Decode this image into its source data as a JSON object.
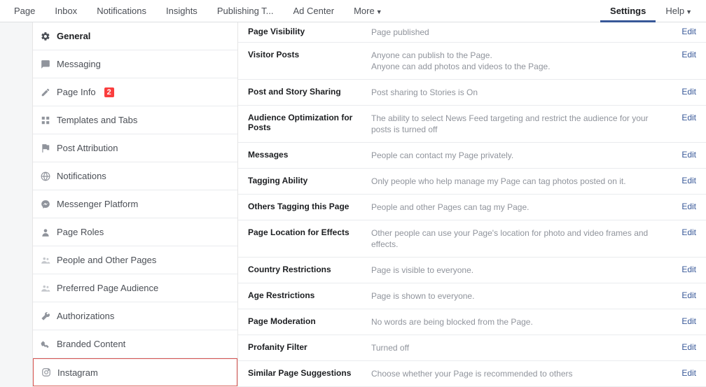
{
  "topnav": {
    "left": [
      {
        "label": "Page"
      },
      {
        "label": "Inbox"
      },
      {
        "label": "Notifications"
      },
      {
        "label": "Insights"
      },
      {
        "label": "Publishing T..."
      },
      {
        "label": "Ad Center"
      },
      {
        "label": "More",
        "caret": true
      }
    ],
    "right": [
      {
        "label": "Settings",
        "active": true
      },
      {
        "label": "Help",
        "caret": true
      }
    ]
  },
  "sidebar": [
    {
      "icon": "gear",
      "label": "General",
      "active": true
    },
    {
      "icon": "chat",
      "label": "Messaging"
    },
    {
      "icon": "pencil",
      "label": "Page Info",
      "badge": "2"
    },
    {
      "icon": "grid",
      "label": "Templates and Tabs"
    },
    {
      "icon": "flag",
      "label": "Post Attribution"
    },
    {
      "icon": "globe",
      "label": "Notifications"
    },
    {
      "icon": "messenger",
      "label": "Messenger Platform"
    },
    {
      "icon": "person",
      "label": "Page Roles"
    },
    {
      "icon": "users",
      "label": "People and Other Pages",
      "dimmed": true
    },
    {
      "icon": "users",
      "label": "Preferred Page Audience",
      "dimmed": true
    },
    {
      "icon": "wrench",
      "label": "Authorizations"
    },
    {
      "icon": "handshake",
      "label": "Branded Content"
    },
    {
      "icon": "instagram",
      "label": "Instagram",
      "highlight": true
    }
  ],
  "edit_label": "Edit",
  "settings": [
    {
      "label": "Page Visibility",
      "desc": "Page published"
    },
    {
      "label": "Visitor Posts",
      "desc": "Anyone can publish to the Page.",
      "desc2": "Anyone can add photos and videos to the Page."
    },
    {
      "label": "Post and Story Sharing",
      "desc": "Post sharing to Stories is On"
    },
    {
      "label": "Audience Optimization for Posts",
      "desc": "The ability to select News Feed targeting and restrict the audience for your posts is turned off"
    },
    {
      "label": "Messages",
      "desc": "People can contact my Page privately."
    },
    {
      "label": "Tagging Ability",
      "desc": "Only people who help manage my Page can tag photos posted on it."
    },
    {
      "label": "Others Tagging this Page",
      "desc": "People and other Pages can tag my Page."
    },
    {
      "label": "Page Location for Effects",
      "desc": "Other people can use your Page's location for photo and video frames and effects."
    },
    {
      "label": "Country Restrictions",
      "desc": "Page is visible to everyone."
    },
    {
      "label": "Age Restrictions",
      "desc": "Page is shown to everyone."
    },
    {
      "label": "Page Moderation",
      "desc": "No words are being blocked from the Page."
    },
    {
      "label": "Profanity Filter",
      "desc": "Turned off"
    },
    {
      "label": "Similar Page Suggestions",
      "desc": "Choose whether your Page is recommended to others"
    }
  ]
}
